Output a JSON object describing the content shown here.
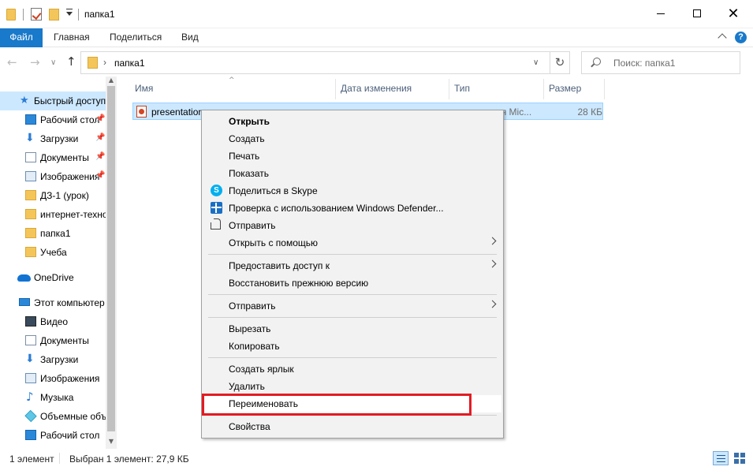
{
  "window": {
    "title": "папка1",
    "close_glyph": "✕"
  },
  "ribbon": {
    "tabs": [
      "Файл",
      "Главная",
      "Поделиться",
      "Вид"
    ],
    "help_glyph": "?"
  },
  "navigation": {
    "back_glyph": "←",
    "forward_glyph": "→",
    "recent_glyph": "∨",
    "up_glyph": "↑",
    "address_separator": "›",
    "address_path": "папка1",
    "address_dropdown_glyph": "∨",
    "refresh_glyph": "↻",
    "search_placeholder": "Поиск: папка1"
  },
  "sidebar": {
    "items": [
      {
        "label": "Быстрый доступ",
        "icon": "star-icon"
      },
      {
        "label": "Рабочий стол",
        "icon": "desktop-icon",
        "pinned": true
      },
      {
        "label": "Загрузки",
        "icon": "downloads-icon",
        "pinned": true
      },
      {
        "label": "Документы",
        "icon": "documents-icon",
        "pinned": true
      },
      {
        "label": "Изображения",
        "icon": "pictures-icon",
        "pinned": true
      },
      {
        "label": "ДЗ-1 (урок)",
        "icon": "folder-icon"
      },
      {
        "label": "интернет-технологии",
        "icon": "folder-icon"
      },
      {
        "label": "папка1",
        "icon": "folder-icon"
      },
      {
        "label": "Учеба",
        "icon": "folder-icon"
      },
      {
        "label": "OneDrive",
        "icon": "onedrive-icon"
      },
      {
        "label": "Этот компьютер",
        "icon": "computer-icon"
      },
      {
        "label": "Видео",
        "icon": "video-icon"
      },
      {
        "label": "Документы",
        "icon": "documents-icon"
      },
      {
        "label": "Загрузки",
        "icon": "downloads-icon"
      },
      {
        "label": "Изображения",
        "icon": "pictures-icon"
      },
      {
        "label": "Музыка",
        "icon": "music-icon"
      },
      {
        "label": "Объемные объекты",
        "icon": "3d-objects-icon"
      },
      {
        "label": "Рабочий стол",
        "icon": "desktop-icon"
      }
    ],
    "pin_glyph": "📌",
    "scroll_up_glyph": "▲",
    "scroll_down_glyph": "▼"
  },
  "columns": {
    "sort_glyph": "^",
    "name": "Имя",
    "modified": "Дата изменения",
    "type": "Тип",
    "size": "Размер"
  },
  "files": [
    {
      "name": "presentation",
      "type": "Презентация Microsoft PowerPoint",
      "type_visible": "ия Mic...",
      "size": "28 КБ",
      "icon": "powerpoint-file-icon",
      "selected": true
    }
  ],
  "context_menu": {
    "items": [
      {
        "label": "Открыть",
        "bold": true
      },
      {
        "label": "Создать"
      },
      {
        "label": "Печать"
      },
      {
        "label": "Показать"
      },
      {
        "label": "Поделиться в Skype",
        "icon": "skype-icon"
      },
      {
        "label": "Проверка с использованием Windows Defender...",
        "icon": "defender-icon"
      },
      {
        "label": "Отправить",
        "icon": "share-icon"
      },
      {
        "label": "Открыть с помощью",
        "submenu": true
      },
      {
        "label": "Предоставить доступ к",
        "submenu": true
      },
      {
        "label": "Восстановить прежнюю версию"
      },
      {
        "label": "Отправить",
        "submenu": true
      },
      {
        "label": "Вырезать"
      },
      {
        "label": "Копировать"
      },
      {
        "label": "Создать ярлык"
      },
      {
        "label": "Удалить"
      },
      {
        "label": "Переименовать",
        "highlighted": true
      },
      {
        "label": "Свойства"
      }
    ],
    "skype_glyph": "S"
  },
  "status": {
    "count": "1 элемент",
    "selection": "Выбран 1 элемент: 27,9 КБ"
  },
  "colors": {
    "accent": "#1979ca",
    "selection": "#cce8ff",
    "highlight_box": "#e31b23"
  }
}
